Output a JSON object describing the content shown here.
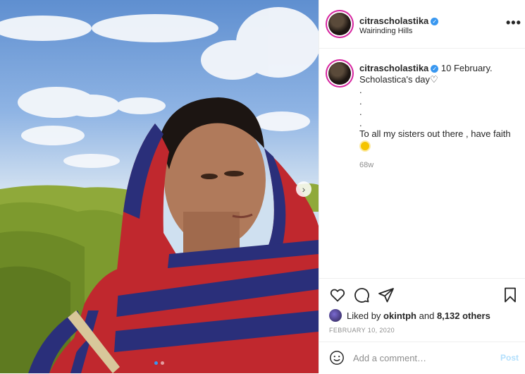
{
  "post": {
    "username": "citrascholastika",
    "location": "Wairinding Hills",
    "more_label": "•••",
    "verified_mark": "✓"
  },
  "caption": {
    "username": "citrascholastika",
    "line1": "10 February.",
    "line2": "Scholastica's day",
    "heart": "♡",
    "dots": [
      ".",
      ".",
      ".",
      "."
    ],
    "line3": "To all my sisters out there , have faith",
    "emoji": "sun-emoji",
    "time_ago": "68w"
  },
  "carousel": {
    "next_label": "›",
    "slide_count": 2,
    "active_index": 1
  },
  "actions": {
    "like_icon": "heart-icon",
    "comment_icon": "comment-icon",
    "share_icon": "share-icon",
    "save_icon": "bookmark-icon"
  },
  "likes": {
    "prefix": "Liked by",
    "user": "okintph",
    "middle": "and",
    "others": "8,132 others"
  },
  "date": "FEBRUARY 10, 2020",
  "comment": {
    "placeholder": "Add a comment…",
    "post_label": "Post"
  },
  "colors": {
    "link_blue": "#3897f0",
    "post_disabled": "#b2dffc",
    "muted": "#8e8e8e",
    "text": "#262626"
  }
}
